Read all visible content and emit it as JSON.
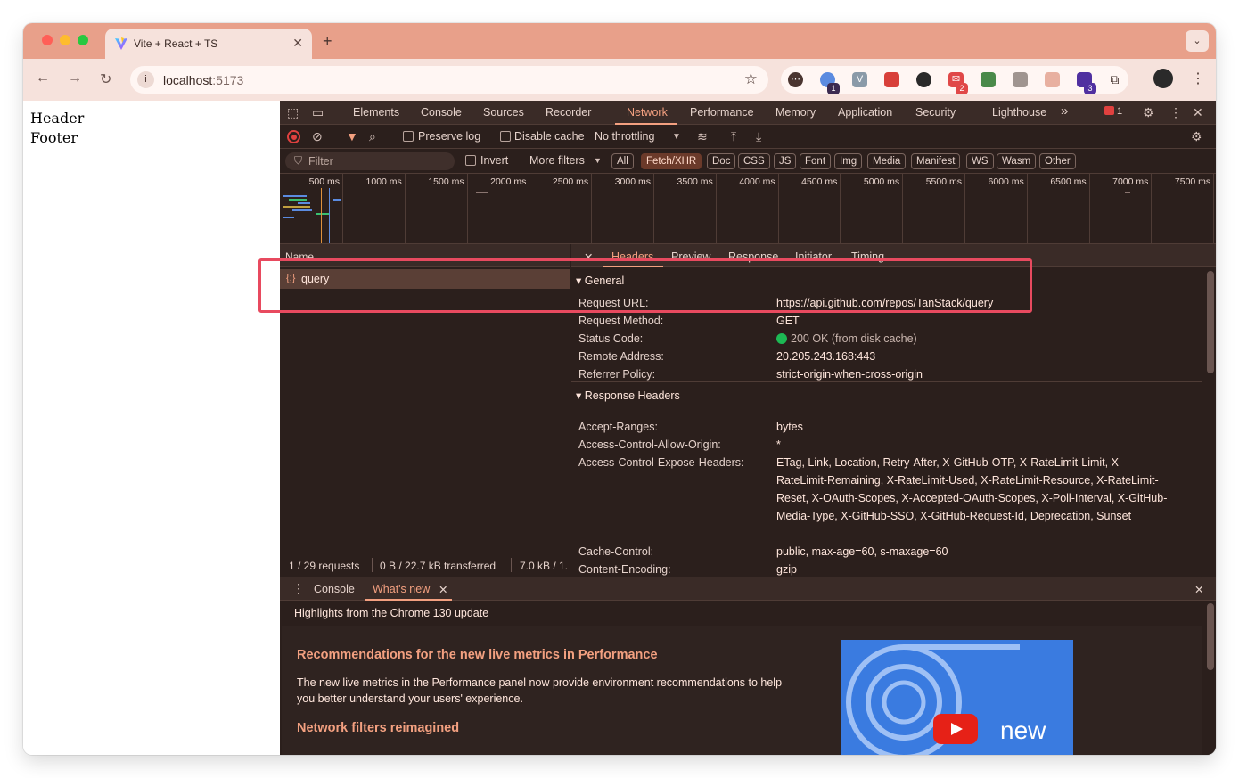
{
  "browser": {
    "tab_title": "Vite + React + TS",
    "tab_close": "✕",
    "new_tab": "+",
    "url_host": "localhost",
    "url_port": ":5173",
    "ext_badges": [
      "1",
      "2",
      "3"
    ]
  },
  "page": {
    "header": "Header",
    "footer": "Footer"
  },
  "devtools": {
    "tabs": [
      "Elements",
      "Console",
      "Sources",
      "Recorder",
      "Network",
      "Performance",
      "Memory",
      "Application",
      "Security",
      "Lighthouse"
    ],
    "more_tabs": "»",
    "error_count": "1",
    "toolbar": {
      "preserve_log": "Preserve log",
      "disable_cache": "Disable cache",
      "throttling": "No throttling"
    },
    "filter": {
      "placeholder": "Filter",
      "invert": "Invert",
      "more_filters": "More filters",
      "types": [
        "All",
        "Fetch/XHR",
        "Doc",
        "CSS",
        "JS",
        "Font",
        "Img",
        "Media",
        "Manifest",
        "WS",
        "Wasm",
        "Other"
      ],
      "active_type": "Fetch/XHR"
    },
    "timeline_ticks": [
      "500 ms",
      "1000 ms",
      "1500 ms",
      "2000 ms",
      "2500 ms",
      "3000 ms",
      "3500 ms",
      "4000 ms",
      "4500 ms",
      "5000 ms",
      "5500 ms",
      "6000 ms",
      "6500 ms",
      "7000 ms",
      "7500 ms"
    ],
    "request_list": {
      "column_name": "Name",
      "rows": [
        {
          "icon": "{;}",
          "name": "query"
        }
      ],
      "status": {
        "requests": "1 / 29 requests",
        "transferred": "0 B / 22.7 kB transferred",
        "resources": "7.0 kB / 1."
      }
    },
    "details": {
      "close": "✕",
      "tabs": [
        "Headers",
        "Preview",
        "Response",
        "Initiator",
        "Timing"
      ],
      "general_title": "▾ General",
      "general": [
        {
          "k": "Request URL:",
          "v": "https://api.github.com/repos/TanStack/query"
        },
        {
          "k": "Request Method:",
          "v": "GET"
        },
        {
          "k": "Status Code:",
          "v": "200 OK (from disk cache)"
        },
        {
          "k": "Remote Address:",
          "v": "20.205.243.168:443"
        },
        {
          "k": "Referrer Policy:",
          "v": "strict-origin-when-cross-origin"
        }
      ],
      "response_title": "▾ Response Headers",
      "response": [
        {
          "k": "Accept-Ranges:",
          "v": "bytes"
        },
        {
          "k": "Access-Control-Allow-Origin:",
          "v": "*"
        },
        {
          "k": "Access-Control-Expose-Headers:",
          "v": "ETag, Link, Location, Retry-After, X-GitHub-OTP, X-RateLimit-Limit, X-RateLimit-Remaining, X-RateLimit-Used, X-RateLimit-Resource, X-RateLimit-Reset, X-OAuth-Scopes, X-Accepted-OAuth-Scopes, X-Poll-Interval, X-GitHub-Media-Type, X-GitHub-SSO, X-GitHub-Request-Id, Deprecation, Sunset"
        },
        {
          "k": "Cache-Control:",
          "v": "public, max-age=60, s-maxage=60"
        },
        {
          "k": "Content-Encoding:",
          "v": "gzip"
        }
      ]
    },
    "drawer": {
      "tabs": [
        "Console",
        "What's new"
      ],
      "tab_close": "✕",
      "close": "✕",
      "highlights": "Highlights from the Chrome 130 update",
      "heading1": "Recommendations for the new live metrics in Performance",
      "paragraph1": "The new live metrics in the Performance panel now provide environment recommendations to help you better understand your users' experience.",
      "heading2": "Network filters reimagined",
      "promo_text": "new"
    }
  },
  "colors": {
    "accent": "#f3a080",
    "titlebar": "#e8a08a",
    "annotation": "#e84a5f",
    "status_ok": "#1db954"
  }
}
